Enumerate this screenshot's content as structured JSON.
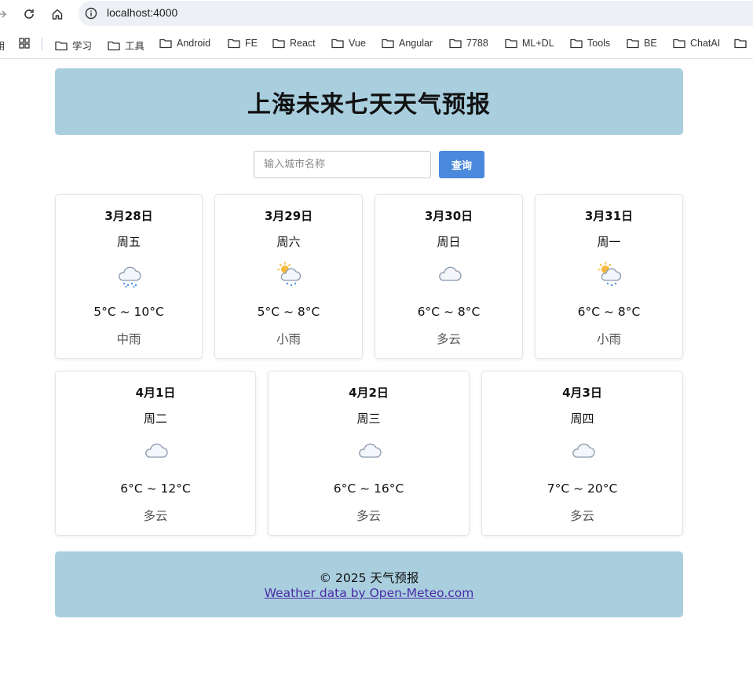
{
  "browser": {
    "url": "localhost:4000",
    "bookmarks_partial": "用",
    "bookmarks": [
      "学习",
      "工具",
      "Android",
      "FE",
      "React",
      "Vue",
      "Angular",
      "7788",
      "ML+DL",
      "Tools",
      "BE",
      "ChatAI"
    ]
  },
  "header": {
    "title": "上海未来七天天气预报"
  },
  "search": {
    "placeholder": "输入城市名称",
    "value": "",
    "button_label": "查询"
  },
  "forecast": [
    {
      "date": "3月28日",
      "weekday": "周五",
      "icon": "rain-cloud-icon",
      "temp": "5°C ~ 10°C",
      "condition": "中雨"
    },
    {
      "date": "3月29日",
      "weekday": "周六",
      "icon": "sun-rain-icon",
      "temp": "5°C ~ 8°C",
      "condition": "小雨"
    },
    {
      "date": "3月30日",
      "weekday": "周日",
      "icon": "cloud-icon",
      "temp": "6°C ~ 8°C",
      "condition": "多云"
    },
    {
      "date": "3月31日",
      "weekday": "周一",
      "icon": "sun-rain-icon",
      "temp": "6°C ~ 8°C",
      "condition": "小雨"
    },
    {
      "date": "4月1日",
      "weekday": "周二",
      "icon": "cloud-icon",
      "temp": "6°C ~ 12°C",
      "condition": "多云"
    },
    {
      "date": "4月2日",
      "weekday": "周三",
      "icon": "cloud-icon",
      "temp": "6°C ~ 16°C",
      "condition": "多云"
    },
    {
      "date": "4月3日",
      "weekday": "周四",
      "icon": "cloud-icon",
      "temp": "7°C ~ 20°C",
      "condition": "多云"
    }
  ],
  "footer": {
    "copyright": "© 2025 天气预报",
    "credit_link": "Weather data by Open-Meteo.com"
  },
  "colors": {
    "header_bg": "#a9cfdf",
    "button_bg": "#4a89dc",
    "link": "#4b2aa6"
  }
}
